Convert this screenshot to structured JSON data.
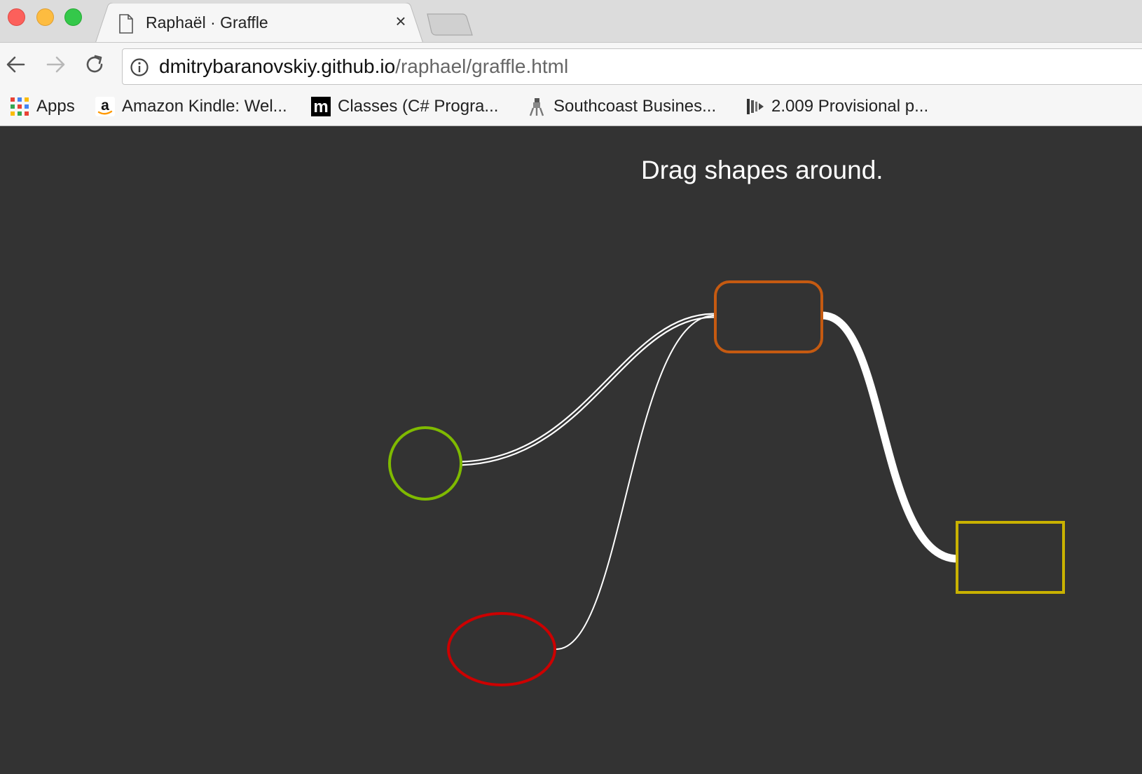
{
  "browser": {
    "tab": {
      "title": "Raphaël · Graffle",
      "close_glyph": "×"
    },
    "address": {
      "host": "dmitrybaranovskiy.github.io",
      "path": "/raphael/graffle.html"
    },
    "bookmarks": [
      {
        "label": "Apps",
        "icon": "apps-grid-icon"
      },
      {
        "label": "Amazon Kindle: Wel...",
        "icon": "amazon-icon"
      },
      {
        "label": "Classes (C# Progra...",
        "icon": "m-logo-icon"
      },
      {
        "label": "Southcoast Busines...",
        "icon": "southcoast-icon"
      },
      {
        "label": "2.009 Provisional p...",
        "icon": "provisional-icon"
      }
    ]
  },
  "page": {
    "heading": "Drag shapes around.",
    "shapes": [
      {
        "id": "orange-rounded-rect",
        "kind": "rounded-rect",
        "color": "#c55a11"
      },
      {
        "id": "green-circle",
        "kind": "circle",
        "color": "#7fba00"
      },
      {
        "id": "red-ellipse",
        "kind": "ellipse",
        "color": "#cc0000"
      },
      {
        "id": "yellow-rect",
        "kind": "rect",
        "color": "#c9b200"
      }
    ],
    "connections": [
      {
        "from": "green-circle",
        "to": "orange-rounded-rect",
        "style": "double-line",
        "color": "#ffffff"
      },
      {
        "from": "red-ellipse",
        "to": "orange-rounded-rect",
        "style": "thin-line",
        "color": "#ffffff"
      },
      {
        "from": "orange-rounded-rect",
        "to": "yellow-rect",
        "style": "thick-line",
        "color": "#ffffff"
      }
    ]
  }
}
